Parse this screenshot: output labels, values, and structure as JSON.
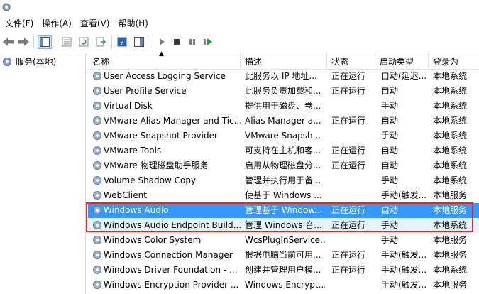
{
  "menu": [
    "文件(F)",
    "操作(A)",
    "查看(V)",
    "帮助(H)"
  ],
  "tree": {
    "root": "服务(本地)"
  },
  "columns": [
    "名称",
    "描述",
    "状态",
    "启动类型",
    "登录为"
  ],
  "services": [
    {
      "name": "User Access Logging Service",
      "desc": "此服务以 IP 地址...",
      "status": "正在运行",
      "start": "自动(延迟...",
      "logon": "本地系统"
    },
    {
      "name": "User Profile Service",
      "desc": "此服务负责加载和...",
      "status": "正在运行",
      "start": "自动",
      "logon": "本地系统"
    },
    {
      "name": "Virtual Disk",
      "desc": "提供用于磁盘、卷...",
      "status": "",
      "start": "手动",
      "logon": "本地系统"
    },
    {
      "name": "VMware Alias Manager and Tic...",
      "desc": "Alias Manager a...",
      "status": "正在运行",
      "start": "自动",
      "logon": "本地系统"
    },
    {
      "name": "VMware Snapshot Provider",
      "desc": "VMware Snapsh...",
      "status": "",
      "start": "手动",
      "logon": "本地系统"
    },
    {
      "name": "VMware Tools",
      "desc": "可支持在主机和客...",
      "status": "正在运行",
      "start": "自动",
      "logon": "本地系统"
    },
    {
      "name": "VMware 物理磁盘助手服务",
      "desc": "启用从物理磁盘分...",
      "status": "正在运行",
      "start": "自动",
      "logon": "本地系统"
    },
    {
      "name": "Volume Shadow Copy",
      "desc": "管理并执行用于备...",
      "status": "",
      "start": "手动",
      "logon": "本地系统"
    },
    {
      "name": "WebClient",
      "desc": "使基于 Windows ...",
      "status": "",
      "start": "手动(触发...",
      "logon": "本地服务"
    },
    {
      "name": "Windows Audio",
      "desc": "管理基于 Window...",
      "status": "正在运行",
      "start": "自动",
      "logon": "本地服务"
    },
    {
      "name": "Windows Audio Endpoint Build...",
      "desc": "管理 Windows 音...",
      "status": "正在运行",
      "start": "手动",
      "logon": "本地系统"
    },
    {
      "name": "Windows Color System",
      "desc": "WcsPlugInService...",
      "status": "",
      "start": "手动",
      "logon": "本地服务"
    },
    {
      "name": "Windows Connection Manager",
      "desc": "根据电脑当前可用...",
      "status": "正在运行",
      "start": "手动(触发...",
      "logon": "本地服务"
    },
    {
      "name": "Windows Driver Foundation - ...",
      "desc": "创建并管理用户模...",
      "status": "正在运行",
      "start": "手动(触发...",
      "logon": "本地系统"
    },
    {
      "name": "Windows Encryption Provider ...",
      "desc": "Windows Encrypt...",
      "status": "",
      "start": "手动(触发...",
      "logon": "本地服务"
    }
  ],
  "selected_row": 9,
  "highlighted_row": 10,
  "colors": {
    "selection": "#3399ff",
    "highlight_border": "#e0282a"
  }
}
